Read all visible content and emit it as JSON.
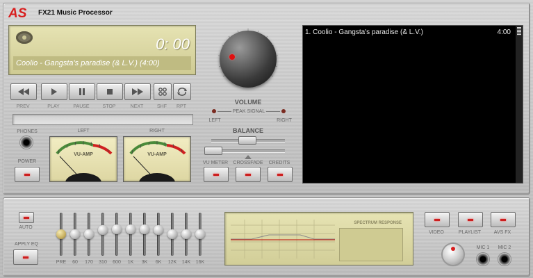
{
  "app": {
    "brand": "AS",
    "product_name": "FX21 Music Processor"
  },
  "lcd": {
    "time": "0: 00",
    "track": "Coolio - Gangsta's paradise (& L.V.) (4:00)"
  },
  "transport": {
    "buttons": [
      {
        "icon": "previous-icon",
        "label": "PREV"
      },
      {
        "icon": "play-icon",
        "label": "PLAY"
      },
      {
        "icon": "pause-icon",
        "label": "PAUSE"
      },
      {
        "icon": "stop-icon",
        "label": "STOP"
      },
      {
        "icon": "next-icon",
        "label": "NEXT"
      },
      {
        "icon": "shuffle-icon",
        "label": "SHF"
      },
      {
        "icon": "repeat-icon",
        "label": "RPT"
      }
    ]
  },
  "left_controls": {
    "phones_label": "PHONES",
    "power_label": "POWER"
  },
  "vu": {
    "left_label": "LEFT",
    "right_label": "RIGHT",
    "meter_title": "VU-AMP"
  },
  "volume": {
    "title": "VOLUME",
    "peak_label": "PEAK SIGNAL",
    "left_label": "LEFT",
    "right_label": "RIGHT"
  },
  "balance": {
    "title": "BALANCE",
    "position": 0.5
  },
  "crossfade_slider": {
    "position": 0.0
  },
  "mode_buttons": {
    "vu_meter": "VU METER",
    "crossfade": "CROSSFADE",
    "credits": "CREDITS"
  },
  "playlist": {
    "rows": [
      {
        "title": "1. Coolio - Gangsta's paradise (& L.V.)",
        "time": "4:00"
      }
    ]
  },
  "eq": {
    "auto_label": "AUTO",
    "apply_label": "APPLY EQ",
    "bands": [
      {
        "label": "PRE",
        "level": 0.5
      },
      {
        "label": "60",
        "level": 0.5
      },
      {
        "label": "170",
        "level": 0.5
      },
      {
        "label": "310",
        "level": 0.6
      },
      {
        "label": "600",
        "level": 0.62
      },
      {
        "label": "1K",
        "level": 0.62
      },
      {
        "label": "3K",
        "level": 0.62
      },
      {
        "label": "6K",
        "level": 0.6
      },
      {
        "label": "12K",
        "level": 0.5
      },
      {
        "label": "14K",
        "level": 0.5
      },
      {
        "label": "16K",
        "level": 0.5
      }
    ]
  },
  "spectrum": {
    "title": "SPECTRUM RESPONSE"
  },
  "right_buttons": {
    "video": "VIDEO",
    "playlist": "PLAYLIST",
    "fx": "AVS FX"
  },
  "mics": {
    "mic1": "MIC 1",
    "mic2": "MIC 2"
  },
  "colors": {
    "brand_red": "#d81e1e",
    "led_red": "#cc1f1f",
    "lcd_bg": "#dcd8a5"
  }
}
